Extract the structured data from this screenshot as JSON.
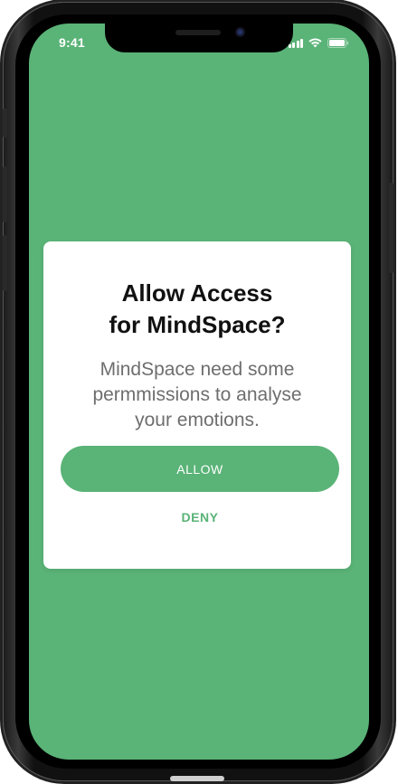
{
  "status_bar": {
    "time": "9:41",
    "signal_icon": "cellular-signal-icon",
    "wifi_icon": "wifi-icon",
    "battery_icon": "battery-icon"
  },
  "dialog": {
    "title_lines": [
      "Allow Access",
      "for MindSpace?"
    ],
    "message_lines": [
      "MindSpace need some",
      "permmissions to analyse",
      "your emotions."
    ],
    "allow_label": "ALLOW",
    "deny_label": "DENY"
  },
  "colors": {
    "background": "#5ab377",
    "accent": "#5ab377",
    "dialog_background": "#ffffff",
    "title_text": "#111111",
    "message_text": "#6e6e6e"
  }
}
